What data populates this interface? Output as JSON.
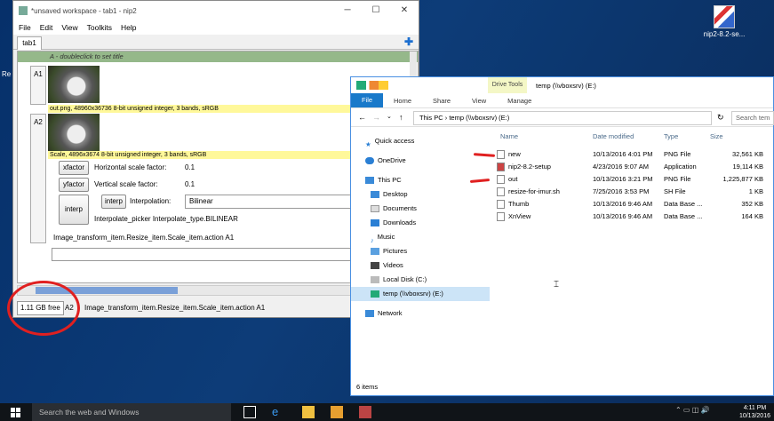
{
  "desktop": {
    "icon_label": "nip2-8.2-se...",
    "left_edge_text": "Re"
  },
  "nip": {
    "title": "*unsaved workspace - tab1 - nip2",
    "menu": [
      "File",
      "Edit",
      "View",
      "Toolkits",
      "Help"
    ],
    "tab": "tab1",
    "column_header": "A - doubleclick to set title",
    "row_a1": {
      "label": "A1",
      "caption": "out.png, 48960x36736 8-bit unsigned integer, 3 bands, sRGB"
    },
    "row_a2": {
      "label": "A2",
      "caption": "Scale, 4896x3674 8-bit unsigned integer, 3 bands, sRGB"
    },
    "xfactor": {
      "button": "xfactor",
      "label": "Horizontal scale factor:",
      "value": "0.1"
    },
    "yfactor": {
      "button": "yfactor",
      "label": "Vertical scale factor:",
      "value": "0.1"
    },
    "interp": {
      "button": "interp",
      "inner_button": "interp",
      "label": "Interpolation:",
      "value": "Bilinear",
      "picker": "Interpolate_picker Interpolate_type.BILINEAR"
    },
    "action": "Image_transform_item.Resize_item.Scale_item.action A1",
    "status": {
      "free": "1.11 GB free",
      "cell": "A2",
      "text": "Image_transform_item.Resize_item.Scale_item.action A1"
    }
  },
  "explorer": {
    "drive_tools": "Drive Tools",
    "title": "temp (\\\\vboxsrv) (E:)",
    "ribbon": [
      "File",
      "Home",
      "Share",
      "View",
      "Manage"
    ],
    "address": [
      "This PC",
      "temp (\\\\vboxsrv) (E:)"
    ],
    "search_placeholder": "Search tem",
    "nav": [
      {
        "label": "Quick access",
        "kind": "star"
      },
      {
        "label": "OneDrive",
        "kind": "cloud"
      },
      {
        "label": "This PC",
        "kind": "pc"
      },
      {
        "label": "Desktop",
        "kind": "folder"
      },
      {
        "label": "Documents",
        "kind": "folder"
      },
      {
        "label": "Downloads",
        "kind": "folder"
      },
      {
        "label": "Music",
        "kind": "folder"
      },
      {
        "label": "Pictures",
        "kind": "folder"
      },
      {
        "label": "Videos",
        "kind": "folder"
      },
      {
        "label": "Local Disk (C:)",
        "kind": "drive"
      },
      {
        "label": "temp (\\\\vboxsrv) (E:)",
        "kind": "netdrive"
      },
      {
        "label": "Network",
        "kind": "network"
      }
    ],
    "columns": [
      "Name",
      "Date modified",
      "Type",
      "Size"
    ],
    "files": [
      {
        "name": "new",
        "date": "10/13/2016 4:01 PM",
        "type": "PNG File",
        "size": "32,561 KB"
      },
      {
        "name": "nip2-8.2-setup",
        "date": "4/23/2016 9:07 AM",
        "type": "Application",
        "size": "19,114 KB"
      },
      {
        "name": "out",
        "date": "10/13/2016 3:21 PM",
        "type": "PNG File",
        "size": "1,225,877 KB"
      },
      {
        "name": "resize-for-imur.sh",
        "date": "7/25/2016 3:53 PM",
        "type": "SH File",
        "size": "1 KB"
      },
      {
        "name": "Thumb",
        "date": "10/13/2016 9:46 AM",
        "type": "Data Base ...",
        "size": "352 KB"
      },
      {
        "name": "XnView",
        "date": "10/13/2016 9:46 AM",
        "type": "Data Base ...",
        "size": "164 KB"
      }
    ],
    "item_count": "6 items"
  },
  "taskbar": {
    "search": "Search the web and Windows",
    "time": "4:11 PM",
    "date": "10/13/2016"
  },
  "colors": {
    "accent": "#1979ca",
    "annotation": "#e02020",
    "yellow": "#fff89a",
    "green": "#95b88a"
  }
}
